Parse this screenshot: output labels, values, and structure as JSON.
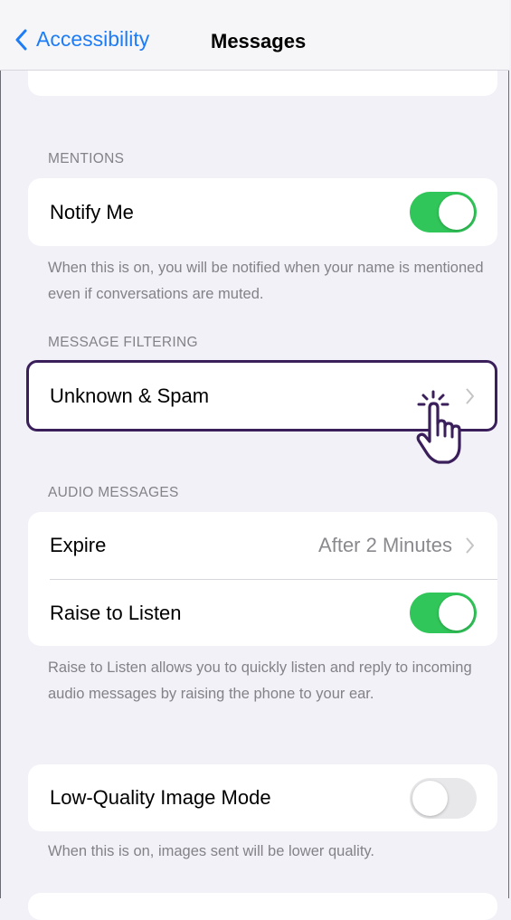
{
  "nav": {
    "back_label": "Accessibility",
    "title": "Messages"
  },
  "mentions": {
    "header": "MENTIONS",
    "notify_label": "Notify Me",
    "notify_on": true,
    "footer": "When this is on, you will be notified when your name is mentioned even if conversations are muted."
  },
  "filtering": {
    "header": "MESSAGE FILTERING",
    "unknown_label": "Unknown & Spam"
  },
  "audio": {
    "header": "AUDIO MESSAGES",
    "expire_label": "Expire",
    "expire_value": "After 2 Minutes",
    "raise_label": "Raise to Listen",
    "raise_on": true,
    "footer": "Raise to Listen allows you to quickly listen and reply to incoming audio messages by raising the phone to your ear."
  },
  "low_quality": {
    "label": "Low-Quality Image Mode",
    "on": false,
    "footer": "When this is on, images sent will be lower quality."
  },
  "colors": {
    "accent": "#1e7cf5",
    "toggle_on": "#31c659",
    "highlight": "#3a1f5a"
  }
}
